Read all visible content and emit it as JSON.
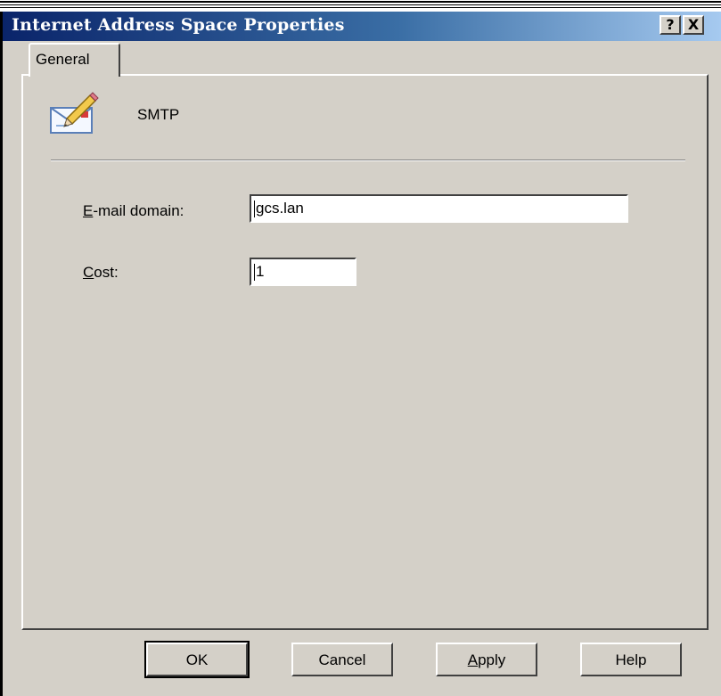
{
  "window": {
    "title": "Internet Address Space Properties",
    "help_glyph": "?",
    "close_glyph": "X"
  },
  "tabs": [
    {
      "label": "General",
      "selected": true
    }
  ],
  "header": {
    "icon": "email-pencil-icon",
    "label": "SMTP"
  },
  "fields": {
    "email_domain": {
      "label_accel": "E",
      "label_rest": "-mail domain:",
      "value": "gcs.lan"
    },
    "cost": {
      "label_accel": "C",
      "label_rest": "ost:",
      "value": "1"
    }
  },
  "buttons": {
    "ok": "OK",
    "cancel": "Cancel",
    "apply_accel": "A",
    "apply_rest": "pply",
    "help": "Help"
  },
  "colors": {
    "face": "#d4d0c8",
    "title_start": "#0a246a",
    "title_end": "#a6caf0"
  }
}
